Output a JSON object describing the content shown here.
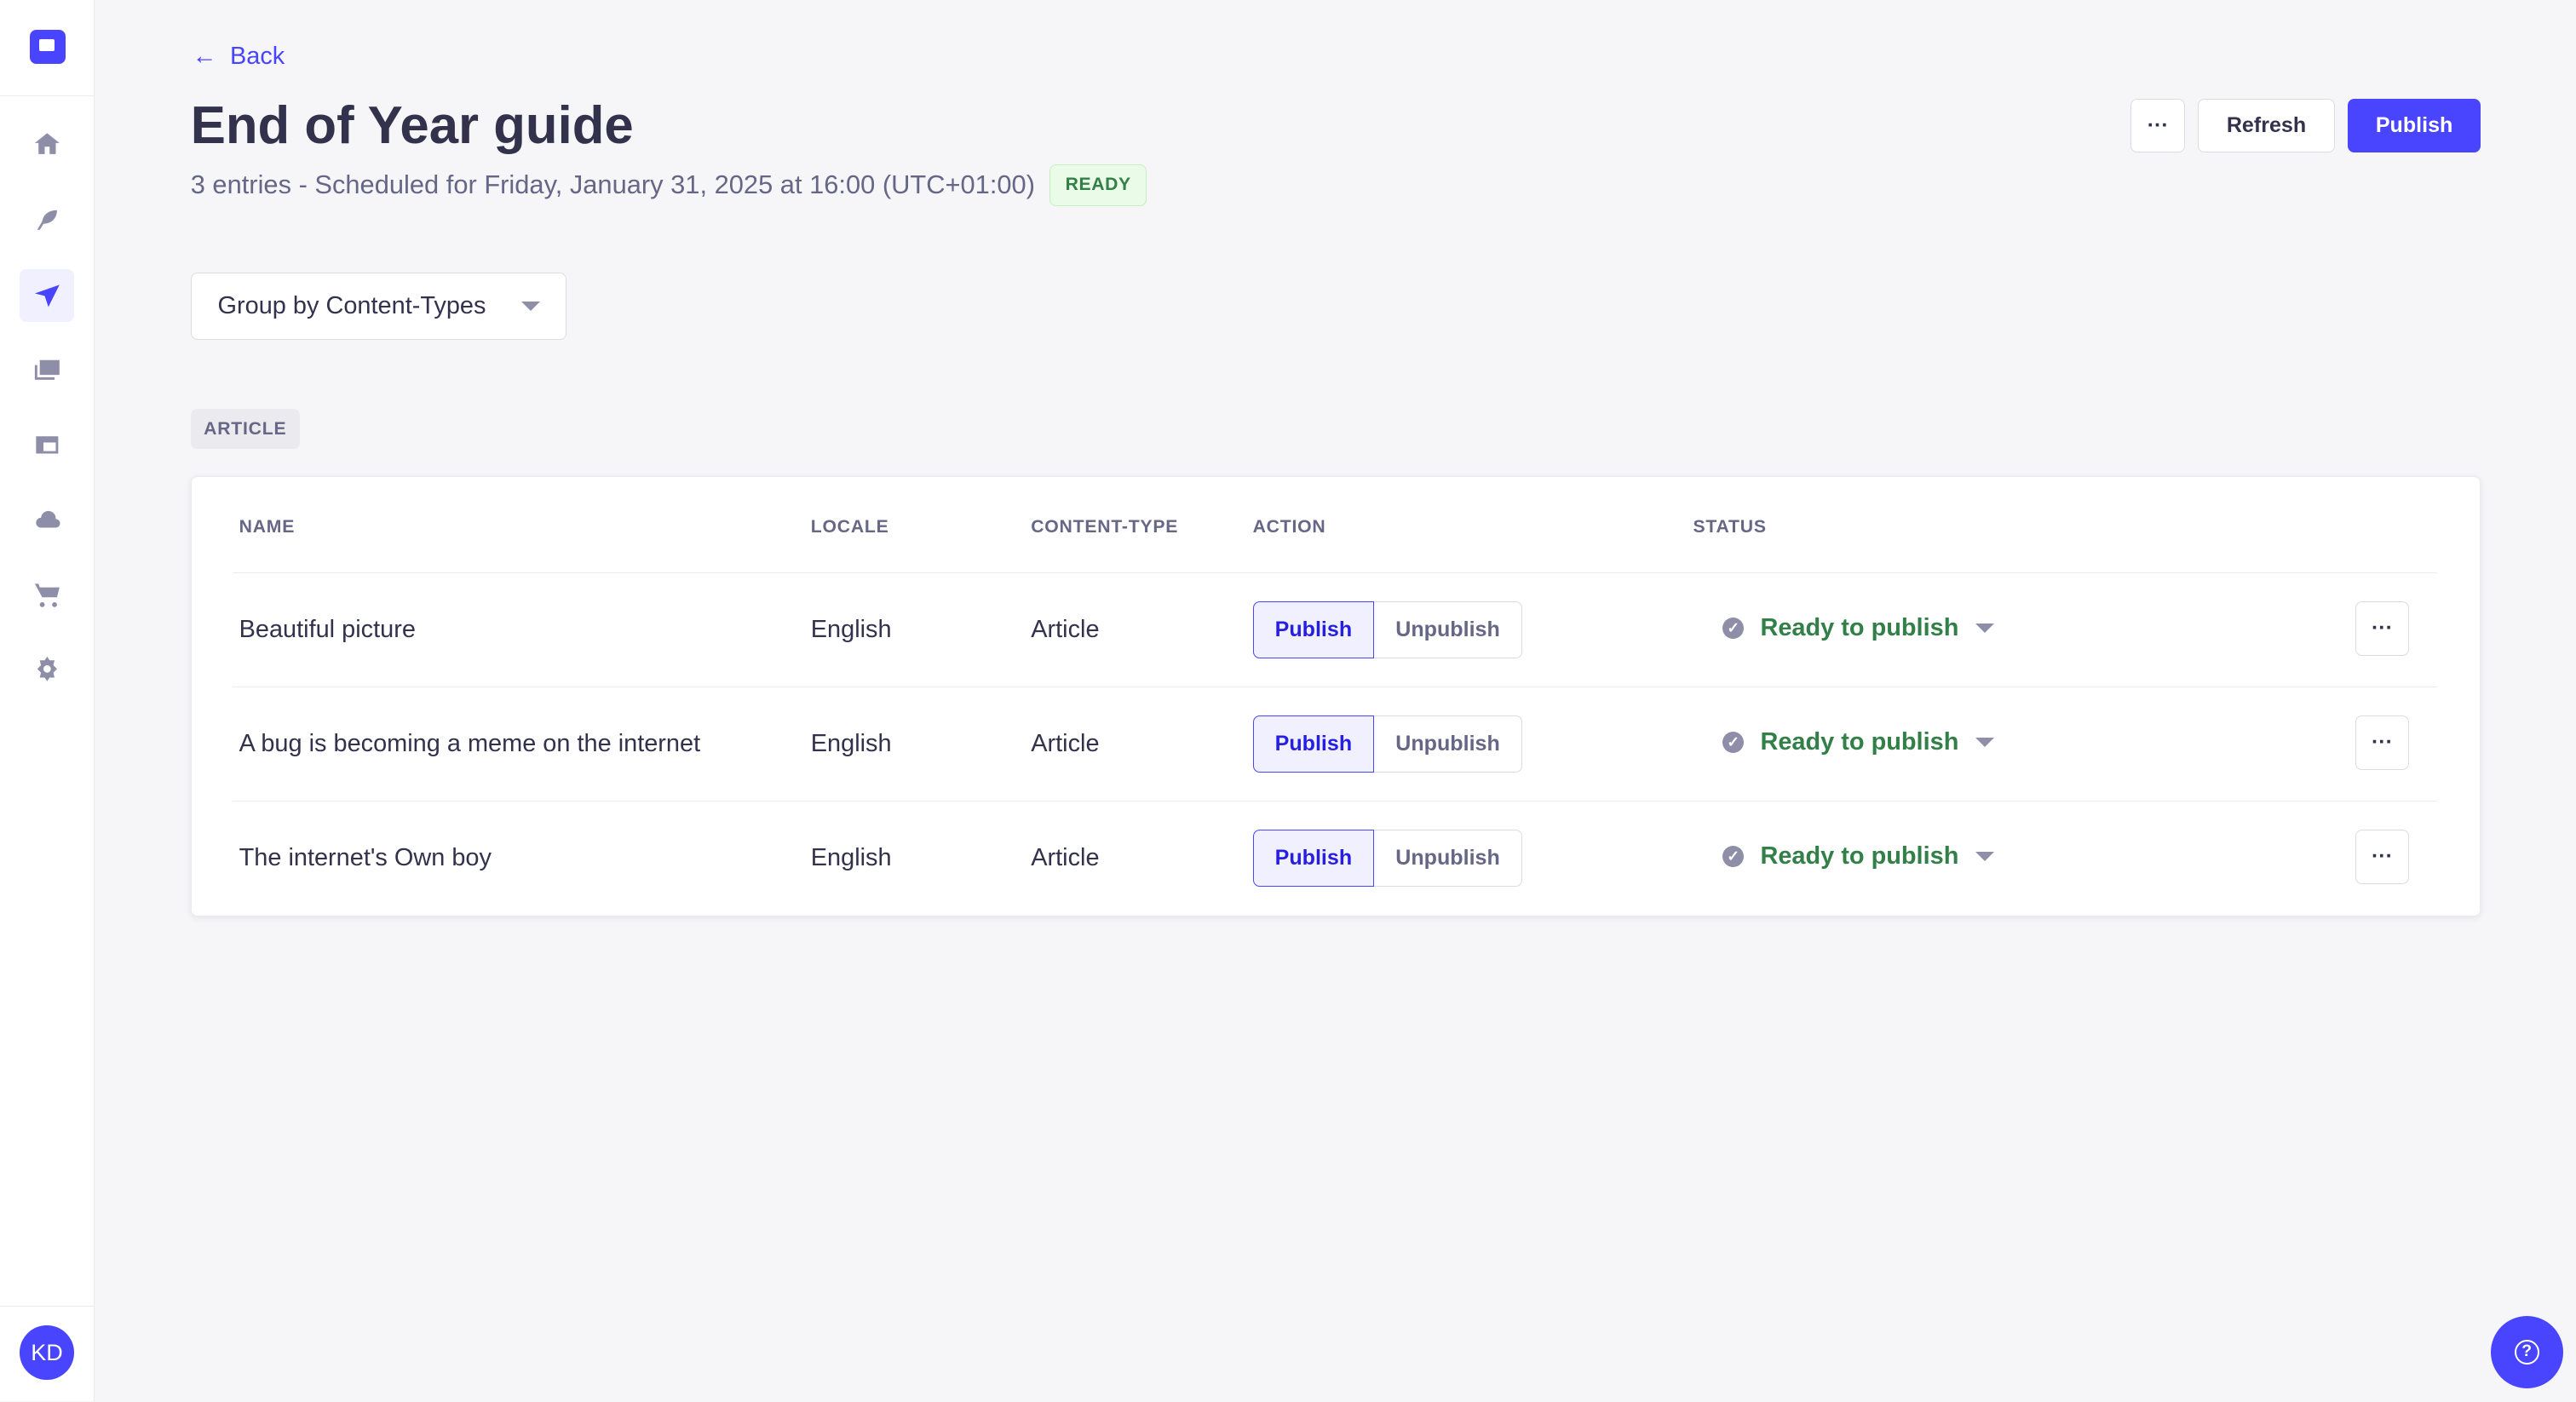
{
  "sidebar": {
    "items": [
      {
        "icon": "home-icon",
        "label": "Home"
      },
      {
        "icon": "feather-icon",
        "label": "Content Manager"
      },
      {
        "icon": "paper-plane-icon",
        "label": "Releases",
        "active": true
      },
      {
        "icon": "images-icon",
        "label": "Media Library"
      },
      {
        "icon": "layout-icon",
        "label": "Content-Type Builder"
      },
      {
        "icon": "cloud-icon",
        "label": "Deploy"
      },
      {
        "icon": "cart-icon",
        "label": "Marketplace"
      },
      {
        "icon": "gear-icon",
        "label": "Settings"
      }
    ],
    "avatar": "KD"
  },
  "header": {
    "back": "Back",
    "title": "End of Year guide",
    "subtitle": "3 entries - Scheduled for Friday, January 31, 2025 at 16:00 (UTC+01:00)",
    "badge": "READY",
    "more": "···",
    "refresh": "Refresh",
    "publish": "Publish"
  },
  "group_select": "Group by Content-Types",
  "group_label": "ARTICLE",
  "table": {
    "columns": [
      "NAME",
      "LOCALE",
      "CONTENT-TYPE",
      "ACTION",
      "STATUS"
    ],
    "rows": [
      {
        "name": "Beautiful picture",
        "locale": "English",
        "type": "Article",
        "publish": "Publish",
        "unpublish": "Unpublish",
        "status": "Ready to publish",
        "more": "···"
      },
      {
        "name": "A bug is becoming a meme on the internet",
        "locale": "English",
        "type": "Article",
        "publish": "Publish",
        "unpublish": "Unpublish",
        "status": "Ready to publish",
        "more": "···"
      },
      {
        "name": "The internet's Own boy",
        "locale": "English",
        "type": "Article",
        "publish": "Publish",
        "unpublish": "Unpublish",
        "status": "Ready to publish",
        "more": "···"
      }
    ]
  },
  "colors": {
    "accent": "#4945ff",
    "success": "#328048"
  }
}
